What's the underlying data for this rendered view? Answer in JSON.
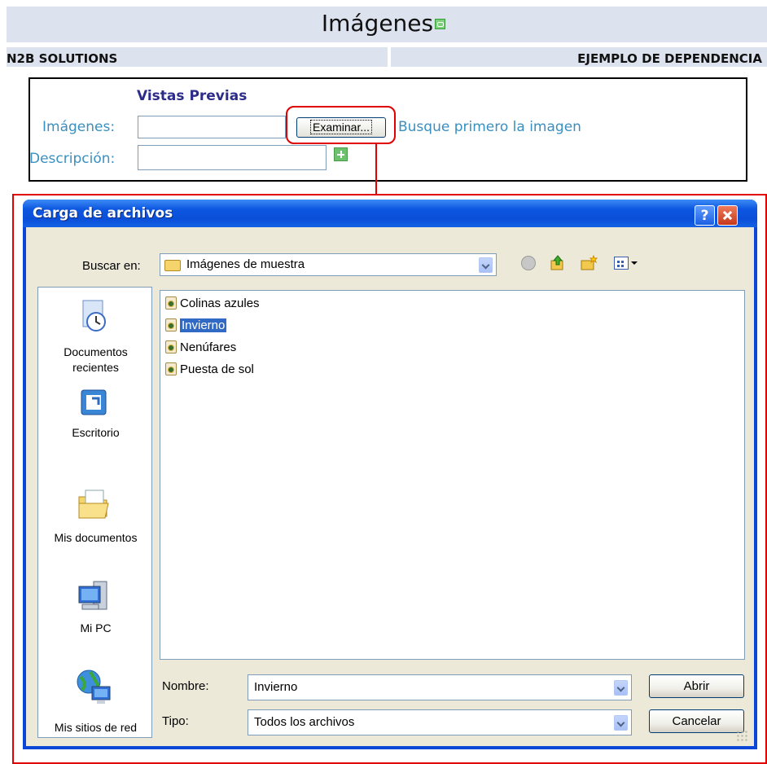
{
  "page": {
    "title": "Imágenes",
    "company": "N2B SOLUTIONS",
    "dependency": "EJEMPLO DE DEPENDENCIA"
  },
  "form": {
    "section_title": "Vistas Previas",
    "images_label": "Imágenes:",
    "images_value": "",
    "browse_button": "Examinar...",
    "browse_hint": "Busque primero la imagen",
    "description_label": "Descripción:",
    "description_value": ""
  },
  "dialog": {
    "title": "Carga de archivos",
    "help_button": "?",
    "look_in_label": "Buscar en:",
    "look_in_value": "Imágenes de muestra",
    "places": [
      {
        "label_line1": "Documentos",
        "label_line2": "recientes"
      },
      {
        "label_line1": "Escritorio",
        "label_line2": ""
      },
      {
        "label_line1": "Mis documentos",
        "label_line2": ""
      },
      {
        "label_line1": "Mi PC",
        "label_line2": ""
      },
      {
        "label_line1": "Mis sitios de red",
        "label_line2": ""
      }
    ],
    "files": [
      {
        "name": "Colinas azules",
        "selected": false
      },
      {
        "name": "Invierno",
        "selected": true
      },
      {
        "name": "Nenúfares",
        "selected": false
      },
      {
        "name": "Puesta de sol",
        "selected": false
      }
    ],
    "filename_label": "Nombre:",
    "filename_value": "Invierno",
    "filetype_label": "Tipo:",
    "filetype_value": "Todos los archivos",
    "open_button": "Abrir",
    "cancel_button": "Cancelar"
  },
  "colors": {
    "highlight": "#e00000",
    "xp_titlebar": "#0a4fd8",
    "selection": "#316ac5",
    "link_text": "#3a8fbf"
  }
}
